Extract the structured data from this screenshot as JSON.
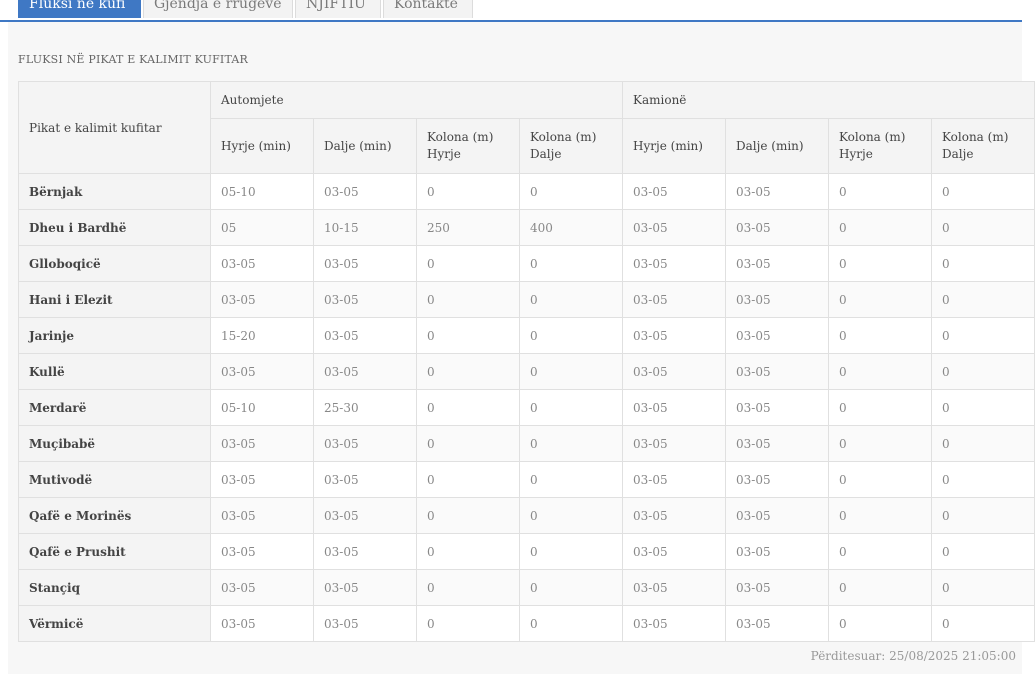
{
  "tabs": [
    {
      "label": "Fluksi në kufi",
      "active": true
    },
    {
      "label": "Gjendja e rrugëve",
      "active": false
    },
    {
      "label": "NJIFTIU",
      "active": false
    },
    {
      "label": "Kontakte",
      "active": false
    }
  ],
  "section_title": "FLUKSI NË PIKAT E KALIMIT KUFITAR",
  "table": {
    "corner_header": "Pikat e kalimit kufitar",
    "groups": [
      "Automjete",
      "Kamionë"
    ],
    "columns": [
      "Hyrje (min)",
      "Dalje (min)",
      "Kolona (m) Hyrje",
      "Kolona (m) Dalje",
      "Hyrje (min)",
      "Dalje (min)",
      "Kolona (m) Hyrje",
      "Kolona (m) Dalje"
    ],
    "rows": [
      {
        "name": "Bërnjak",
        "values": [
          "05-10",
          "03-05",
          "0",
          "0",
          "03-05",
          "03-05",
          "0",
          "0"
        ]
      },
      {
        "name": "Dheu i Bardhë",
        "values": [
          "05",
          "10-15",
          "250",
          "400",
          "03-05",
          "03-05",
          "0",
          "0"
        ]
      },
      {
        "name": "Glloboqicë",
        "values": [
          "03-05",
          "03-05",
          "0",
          "0",
          "03-05",
          "03-05",
          "0",
          "0"
        ]
      },
      {
        "name": "Hani i Elezit",
        "values": [
          "03-05",
          "03-05",
          "0",
          "0",
          "03-05",
          "03-05",
          "0",
          "0"
        ]
      },
      {
        "name": "Jarinje",
        "values": [
          "15-20",
          "03-05",
          "0",
          "0",
          "03-05",
          "03-05",
          "0",
          "0"
        ]
      },
      {
        "name": "Kullë",
        "values": [
          "03-05",
          "03-05",
          "0",
          "0",
          "03-05",
          "03-05",
          "0",
          "0"
        ]
      },
      {
        "name": "Merdarë",
        "values": [
          "05-10",
          "25-30",
          "0",
          "0",
          "03-05",
          "03-05",
          "0",
          "0"
        ]
      },
      {
        "name": "Muçibabë",
        "values": [
          "03-05",
          "03-05",
          "0",
          "0",
          "03-05",
          "03-05",
          "0",
          "0"
        ]
      },
      {
        "name": "Mutivodë",
        "values": [
          "03-05",
          "03-05",
          "0",
          "0",
          "03-05",
          "03-05",
          "0",
          "0"
        ]
      },
      {
        "name": "Qafë e Morinës",
        "values": [
          "03-05",
          "03-05",
          "0",
          "0",
          "03-05",
          "03-05",
          "0",
          "0"
        ]
      },
      {
        "name": "Qafë e Prushit",
        "values": [
          "03-05",
          "03-05",
          "0",
          "0",
          "03-05",
          "03-05",
          "0",
          "0"
        ]
      },
      {
        "name": "Stançiq",
        "values": [
          "03-05",
          "03-05",
          "0",
          "0",
          "03-05",
          "03-05",
          "0",
          "0"
        ]
      },
      {
        "name": "Vërmicë",
        "values": [
          "03-05",
          "03-05",
          "0",
          "0",
          "03-05",
          "03-05",
          "0",
          "0"
        ]
      }
    ]
  },
  "updated": {
    "label": "Përditesuar:",
    "value": "25/08/2025 21:05:00"
  },
  "colors": {
    "accent": "#3f78c4"
  }
}
